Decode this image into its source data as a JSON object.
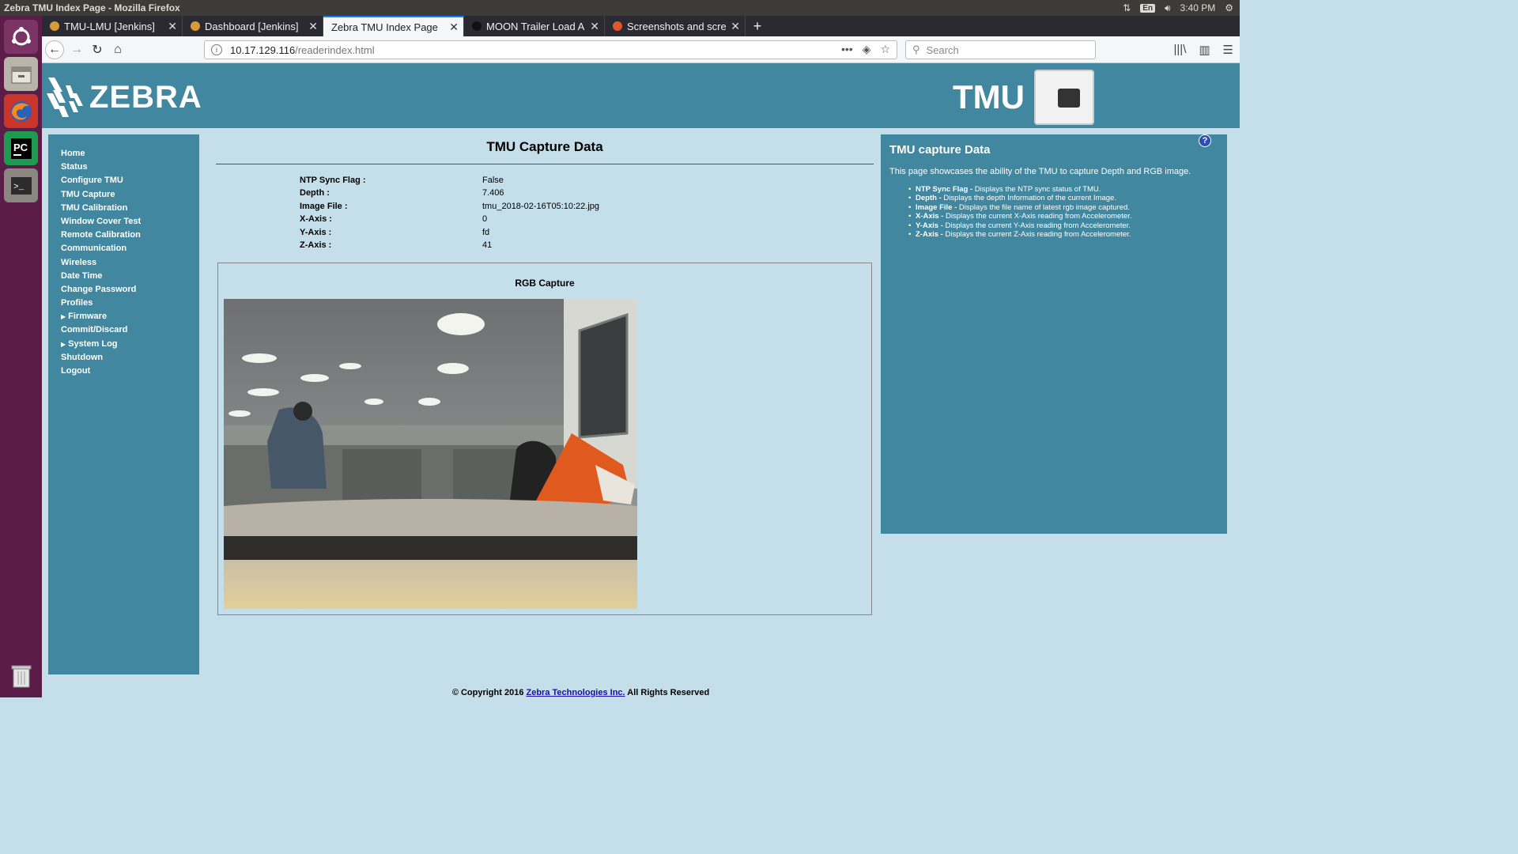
{
  "os": {
    "window_title": "Zebra TMU Index Page - Mozilla Firefox",
    "keyboard": "En",
    "clock": "3:40 PM"
  },
  "browser": {
    "tabs": [
      {
        "label": "TMU-LMU [Jenkins]",
        "color": "#d99a3c"
      },
      {
        "label": "Dashboard [Jenkins]",
        "color": "#d99a3c"
      },
      {
        "label": "Zebra TMU Index Page",
        "color": "#40879f"
      },
      {
        "label": "MOON Trailer Load Ana",
        "color": "#111111"
      },
      {
        "label": "Screenshots and screen",
        "color": "#e0572a"
      }
    ],
    "url_host": "10.17.129.116",
    "url_path": "/readerindex.html",
    "search_placeholder": "Search"
  },
  "header": {
    "brand": "ZEBRA",
    "product": "TMU"
  },
  "sidebar": {
    "items": [
      {
        "label": "Home",
        "expandable": false
      },
      {
        "label": "Status",
        "expandable": false
      },
      {
        "label": "Configure TMU",
        "expandable": false
      },
      {
        "label": "TMU Capture",
        "expandable": false
      },
      {
        "label": "TMU Calibration",
        "expandable": false
      },
      {
        "label": "Window Cover Test",
        "expandable": false
      },
      {
        "label": "Remote Calibration",
        "expandable": false
      },
      {
        "label": "Communication",
        "expandable": false
      },
      {
        "label": "Wireless",
        "expandable": false
      },
      {
        "label": "Date Time",
        "expandable": false
      },
      {
        "label": "Change Password",
        "expandable": false
      },
      {
        "label": "Profiles",
        "expandable": false
      },
      {
        "label": "Firmware",
        "expandable": true
      },
      {
        "label": "Commit/Discard",
        "expandable": false
      },
      {
        "label": "System Log",
        "expandable": true
      },
      {
        "label": "Shutdown",
        "expandable": false
      },
      {
        "label": "Logout",
        "expandable": false
      }
    ]
  },
  "main": {
    "title": "TMU Capture Data",
    "fields": [
      {
        "label": "NTP Sync Flag :",
        "value": "False"
      },
      {
        "label": "Depth :",
        "value": "7.406"
      },
      {
        "label": "Image File :",
        "value": "tmu_2018-02-16T05:10:22.jpg"
      },
      {
        "label": "X-Axis :",
        "value": "0"
      },
      {
        "label": "Y-Axis :",
        "value": "fd"
      },
      {
        "label": "Z-Axis :",
        "value": "41"
      }
    ],
    "rgb_title": "RGB Capture"
  },
  "help": {
    "title": "TMU capture Data",
    "intro": "This page showcases the ability of the TMU to capture Depth and RGB image.",
    "items": [
      {
        "term": "NTP Sync Flag -",
        "desc": " Displays the NTP sync status of TMU."
      },
      {
        "term": "Depth -",
        "desc": " Displays the depth Information of the current Image."
      },
      {
        "term": "Image File -",
        "desc": " Displays the file name of latest rgb image captured."
      },
      {
        "term": "X-Axis -",
        "desc": " Displays the current X-Axis reading from Accelerometer."
      },
      {
        "term": "Y-Axis -",
        "desc": " Displays the current Y-Axis reading from Accelerometer."
      },
      {
        "term": "Z-Axis -",
        "desc": " Displays the current Z-Axis reading from Accelerometer."
      }
    ]
  },
  "footer": {
    "prefix": "© Copyright 2016 ",
    "link": "Zebra Technologies Inc.",
    "suffix": " All Rights Reserved"
  }
}
